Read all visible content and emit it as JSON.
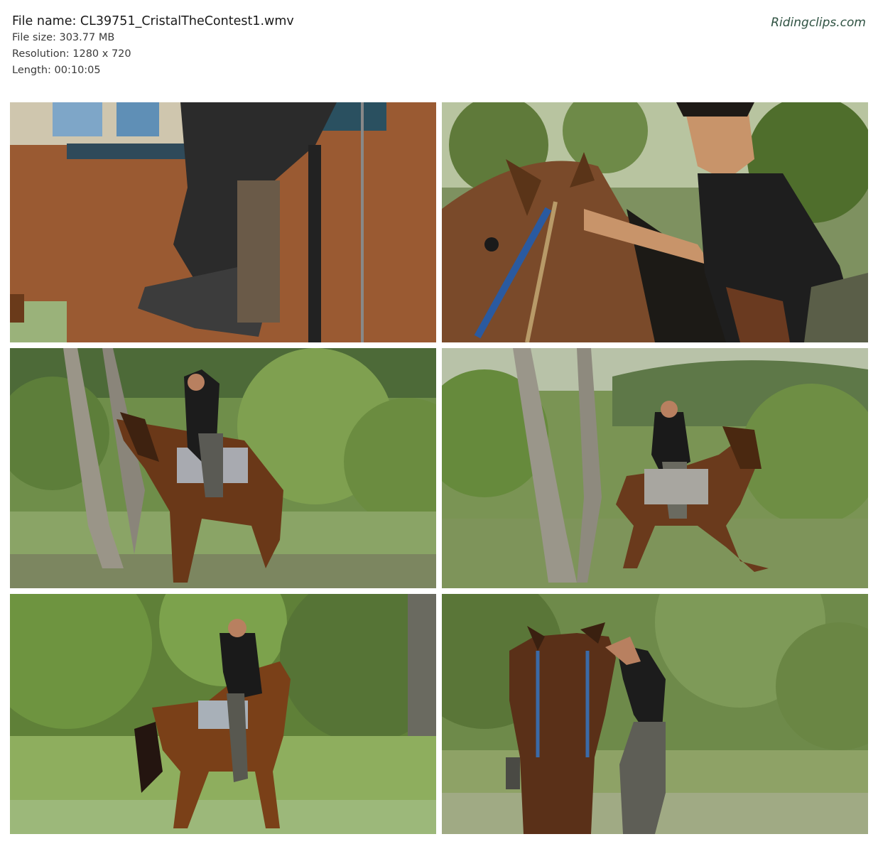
{
  "header": {
    "file_name": "File name: CL39751_CristalTheContest1.wmv",
    "file_size": "File size: 303.77 MB",
    "resolution": "Resolution: 1280 x 720",
    "length": "Length: 00:10:05"
  },
  "brand": {
    "watermark": "Ridingclips.com",
    "color": "#2f5242"
  },
  "thumbnails": [
    {
      "scene": "close-up of rider boot in stirrup on brown horse"
    },
    {
      "scene": "rider in black top leaning over horse neck with blue bridle"
    },
    {
      "scene": "rider on brown horse beside tree in green brush"
    },
    {
      "scene": "rider on brown horse walking past tree, hills behind"
    },
    {
      "scene": "rider on bay horse walking toward camera on grass"
    },
    {
      "scene": "rider mounting brown horse in wooded field"
    }
  ]
}
